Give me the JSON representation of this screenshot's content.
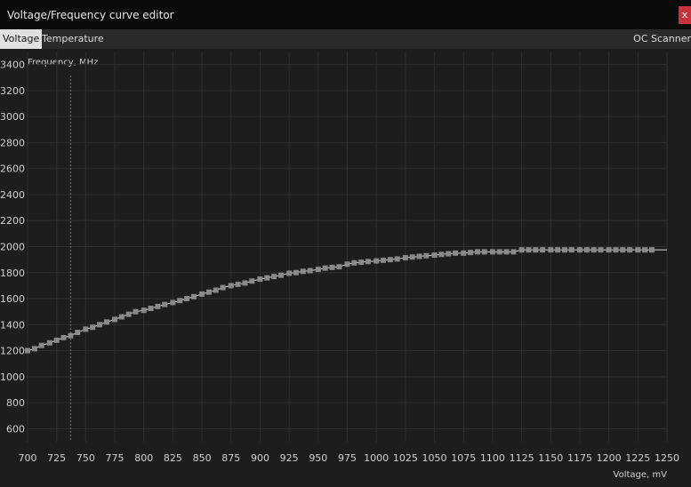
{
  "window": {
    "title": "Voltage/Frequency curve editor",
    "close_label": "x"
  },
  "tabs": [
    {
      "label": "Voltage",
      "active": true
    },
    {
      "label": "Temperature",
      "active": false
    }
  ],
  "oc_scanner_label": "OC Scanner",
  "colors": {
    "background": "#1d1d1f",
    "titlebar": "#0b0b0c",
    "close_button": "#c8323a",
    "curve_line": "#d8d8d8",
    "curve_point": "#8a8a8a",
    "grid": "#2e2e31"
  },
  "chart_data": {
    "type": "line",
    "title": "",
    "ylabel": "Frequency, MHz",
    "xlabel": "Voltage, mV",
    "xlim": [
      700,
      1250
    ],
    "ylim": [
      500,
      3500
    ],
    "x_ticks": [
      700,
      725,
      750,
      775,
      800,
      825,
      850,
      875,
      900,
      925,
      950,
      975,
      1000,
      1025,
      1050,
      1075,
      1100,
      1125,
      1150,
      1175,
      1200,
      1225,
      1250
    ],
    "y_ticks": [
      600,
      800,
      1000,
      1200,
      1400,
      1600,
      1800,
      2000,
      2200,
      2400,
      2600,
      2800,
      3000,
      3200,
      3400
    ],
    "grid": true,
    "marker_voltage": 737,
    "series": [
      {
        "x": [
          700,
          706,
          712,
          719,
          725,
          731,
          737,
          743,
          750,
          756,
          762,
          768,
          775,
          781,
          787,
          793,
          800,
          806,
          812,
          818,
          825,
          831,
          837,
          843,
          850,
          856,
          862,
          868,
          875,
          881,
          887,
          893,
          900,
          906,
          912,
          918,
          925,
          931,
          937,
          943,
          950,
          956,
          962,
          968,
          975,
          981,
          987,
          993,
          1000,
          1006,
          1012,
          1018,
          1025,
          1031,
          1037,
          1043,
          1050,
          1056,
          1062,
          1068,
          1075,
          1081,
          1087,
          1093,
          1100,
          1106,
          1112,
          1118,
          1125,
          1131,
          1137,
          1143,
          1150,
          1156,
          1162,
          1168,
          1175,
          1181,
          1187,
          1193,
          1200,
          1206,
          1212,
          1218,
          1225,
          1231,
          1237
        ],
        "y": [
          1200,
          1215,
          1240,
          1260,
          1280,
          1300,
          1315,
          1340,
          1365,
          1380,
          1400,
          1420,
          1440,
          1460,
          1480,
          1500,
          1510,
          1525,
          1540,
          1555,
          1570,
          1585,
          1600,
          1615,
          1635,
          1650,
          1665,
          1685,
          1700,
          1710,
          1720,
          1735,
          1750,
          1760,
          1770,
          1780,
          1795,
          1800,
          1810,
          1815,
          1825,
          1835,
          1840,
          1845,
          1865,
          1875,
          1880,
          1885,
          1890,
          1895,
          1900,
          1905,
          1915,
          1920,
          1925,
          1930,
          1935,
          1940,
          1945,
          1950,
          1950,
          1955,
          1960,
          1960,
          1960,
          1960,
          1960,
          1960,
          1975,
          1975,
          1975,
          1975,
          1975,
          1975,
          1975,
          1975,
          1975,
          1975,
          1975,
          1975,
          1975,
          1975,
          1975,
          1975,
          1975,
          1975,
          1975
        ],
        "extended_to": [
          1250,
          1975
        ]
      }
    ]
  }
}
